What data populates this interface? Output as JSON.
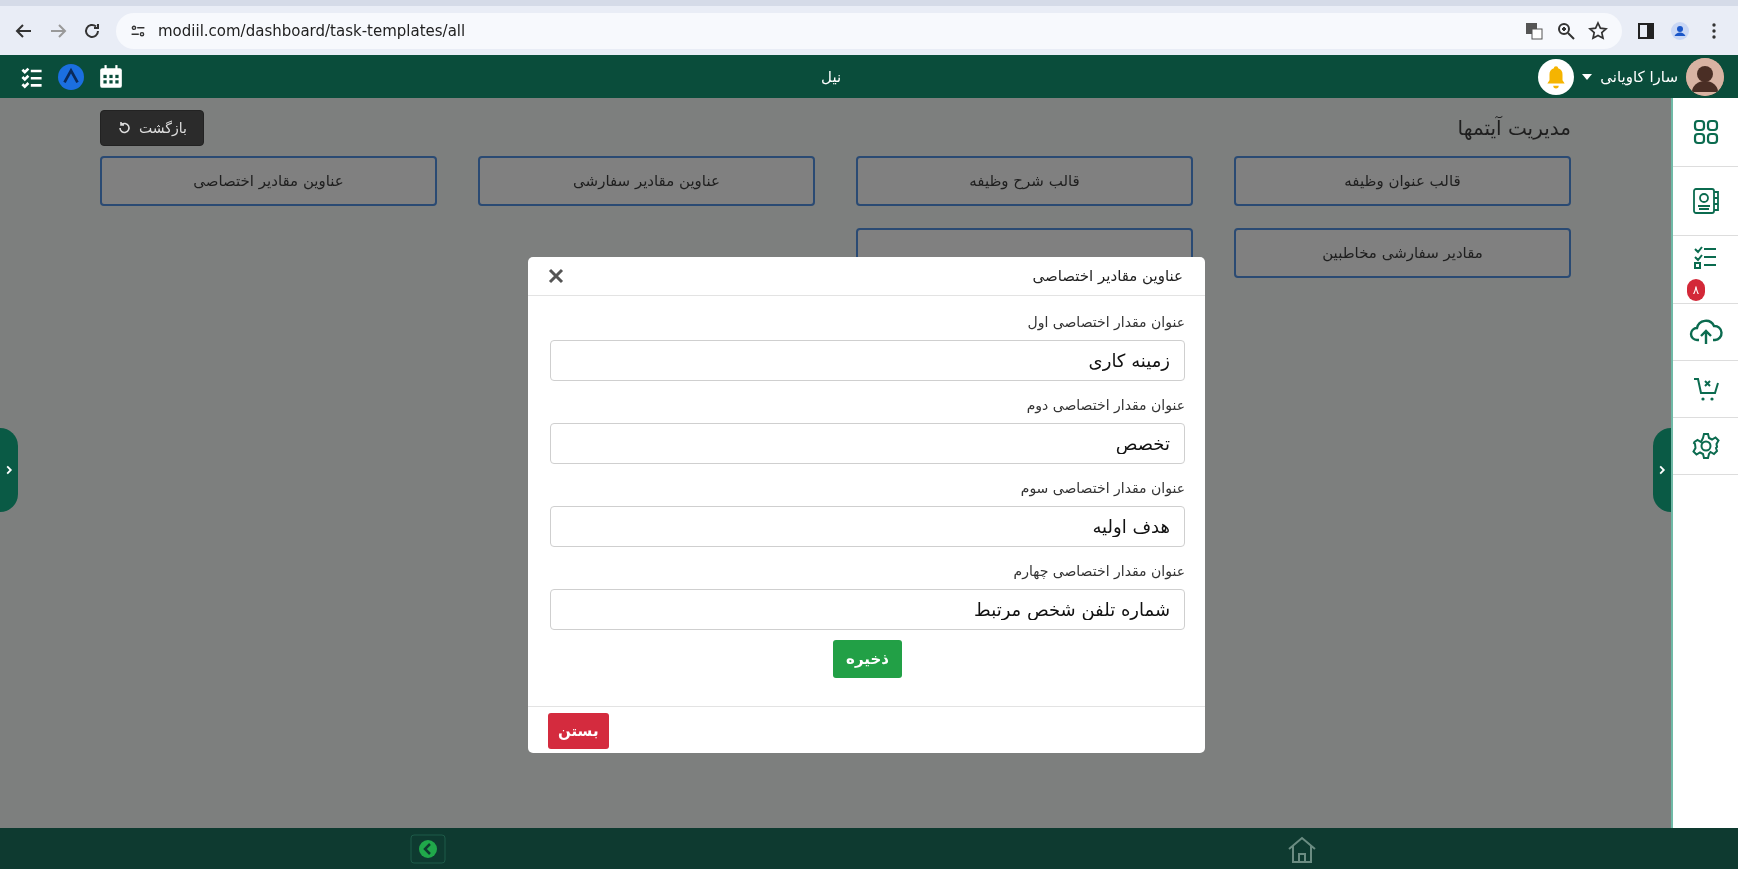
{
  "browser": {
    "url": "modiil.com/dashboard/task-templates/all"
  },
  "header": {
    "title": "نیل",
    "user_name": "سارا کاویانی"
  },
  "page": {
    "title": "مدیریت آیتمها",
    "back_button": "بازگشت",
    "items": [
      "قالب عنوان وظیفه",
      "قالب شرح وظیفه",
      "عناوین مقادیر سفارشی",
      "عناوین مقادیر اختصاصی",
      "مقادیر سفارشی مخاطبین"
    ]
  },
  "sidebar": {
    "badge": "۸"
  },
  "modal": {
    "title": "عناوین مقادیر اختصاصی",
    "fields": [
      {
        "label": "عنوان مقدار اختصاصی اول",
        "value": "زمینه کاری"
      },
      {
        "label": "عنوان مقدار اختصاصی دوم",
        "value": "تخصص"
      },
      {
        "label": "عنوان مقدار اختصاصی سوم",
        "value": "هدف اولیه"
      },
      {
        "label": "عنوان مقدار اختصاصی چهارم",
        "value": "شماره تلفن شخص مرتبط"
      }
    ],
    "save_button": "ذخیره",
    "close_button": "بستن"
  }
}
